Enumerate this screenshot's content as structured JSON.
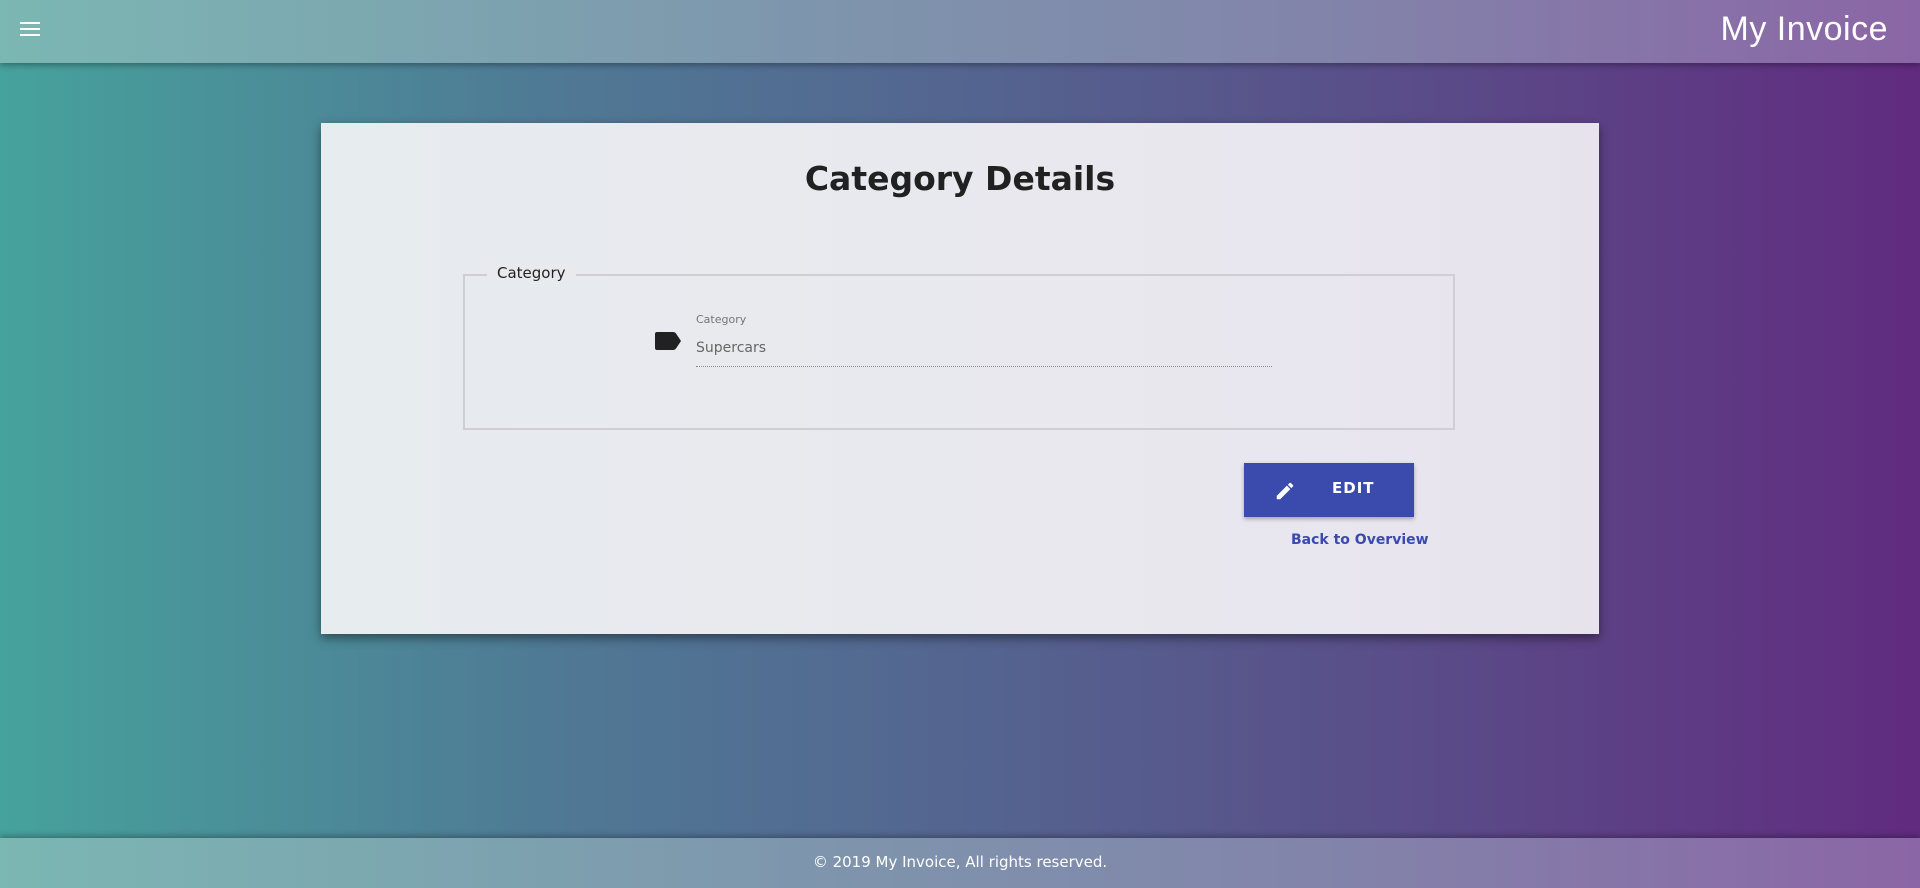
{
  "header": {
    "app_title": "My Invoice",
    "menu_icon": "hamburger-menu-icon"
  },
  "card": {
    "title": "Category Details",
    "section": {
      "legend": "Category",
      "field": {
        "icon": "tag-icon",
        "label": "Category",
        "value": "Supercars"
      }
    },
    "edit_button": {
      "icon": "pencil-icon",
      "label": "EDIT"
    },
    "back_link": "Back to Overview"
  },
  "footer": {
    "text": "© 2019 My Invoice, All rights reserved."
  },
  "colors": {
    "primary": "#3a4aad",
    "gradient_start": "#46a29c",
    "gradient_end": "#612b80"
  }
}
